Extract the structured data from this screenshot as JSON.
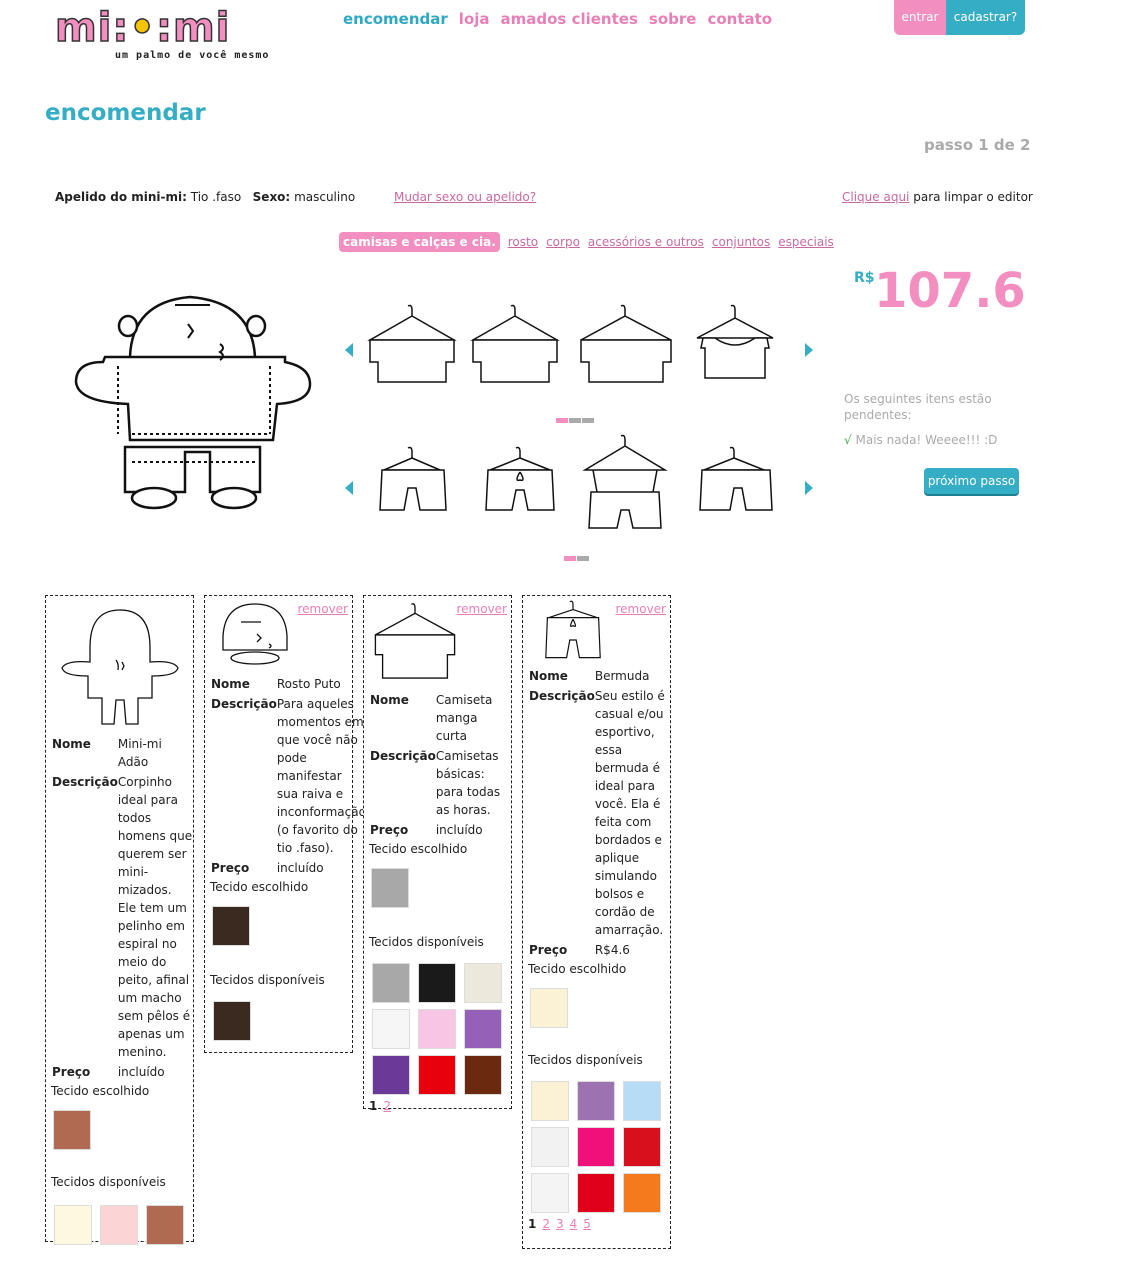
{
  "logo": {
    "wordmark_a": "mi",
    "wordmark_dot": "•",
    "wordmark_b": "mi",
    "tagline": "um palmo de você mesmo",
    "sep": ":"
  },
  "nav": {
    "items": [
      "encomendar",
      "loja",
      "amados clientes",
      "sobre",
      "contato"
    ],
    "active": "encomendar"
  },
  "auth": {
    "login": "entrar",
    "signup": "cadastrar?"
  },
  "page": {
    "title": "encomendar",
    "step": "passo 1 de 2"
  },
  "info": {
    "nickname_label": "Apelido do mini-mi:",
    "nickname_value": "Tio .faso",
    "sex_label": "Sexo:",
    "sex_value": "masculino",
    "change_link": "Mudar sexo ou apelido?",
    "clear_link": "Clique aqui",
    "clear_text": "para limpar o editor"
  },
  "categories": [
    "camisas e calças e cia.",
    "rosto",
    "corpo",
    "acessórios e outros",
    "conjuntos",
    "especiais"
  ],
  "carousel": {
    "shirts": [
      "hanger-shirt-icon",
      "hanger-shirt-icon",
      "hanger-shirt-icon",
      "hanger-tanktop-icon"
    ],
    "shorts": [
      "hanger-shorts-icon",
      "hanger-shorts-icon",
      "hanger-overall-shorts-icon",
      "hanger-shorts-icon"
    ]
  },
  "price": {
    "currency": "R$",
    "value": "107.6"
  },
  "pending": {
    "text": "Os seguintes itens estão pendentes:",
    "check": "√",
    "done": "Mais nada! Weeee!!! :D"
  },
  "next_button": "próximo passo",
  "colors": {
    "pink": "#f28fc0",
    "teal": "#35adc4",
    "grey": "#aaaaaa"
  },
  "cards": [
    {
      "name_label": "Nome",
      "name": "Mini-mi Adão",
      "desc_label": "Descrição",
      "desc": "Corpinho ideal para todos homens que querem ser mini-mizados. Ele tem um pelinho em espiral no meio do peito, afinal um macho sem pêlos é apenas um menino.",
      "price_label": "Preço",
      "price": "incluído",
      "chosen_label": "Tecido escolhido",
      "chosen_color": "#b06a52",
      "available_label": "Tecidos disponíveis",
      "available": [
        "#fdf8e0",
        "#fbd4d6",
        "#b06a52"
      ]
    },
    {
      "remove": "remover",
      "name_label": "Nome",
      "name": "Rosto Puto",
      "desc_label": "Descrição",
      "desc": "Para aqueles momentos em que você não pode manifestar sua raiva e inconformação (o favorito do tio .faso).",
      "price_label": "Preço",
      "price": "incluído",
      "chosen_label": "Tecido escolhido",
      "chosen_color": "#3a2a20",
      "available_label": "Tecidos disponíveis",
      "available": [
        "#3a2a20"
      ]
    },
    {
      "remove": "remover",
      "name_label": "Nome",
      "name": "Camiseta manga curta",
      "desc_label": "Descrição",
      "desc": "Camisetas básicas: para todas as horas.",
      "price_label": "Preço",
      "price": "incluído",
      "chosen_label": "Tecido escolhido",
      "chosen_color": "#a8a8a8",
      "available_label": "Tecidos disponíveis",
      "available": [
        "#a8a8a8",
        "#1a1a1a",
        "#ece8dc",
        "#f6f6f6",
        "#f6c6e4",
        "#9460b8",
        "#6b3a98",
        "#e8000c",
        "#6b2a10"
      ],
      "pages": [
        "1",
        "2"
      ]
    },
    {
      "remove": "remover",
      "name_label": "Nome",
      "name": "Bermuda",
      "desc_label": "Descrição",
      "desc": "Seu estilo é casual e/ou esportivo, essa bermuda é ideal para você. Ela é feita com bordados e aplique simulando bolsos e cordão de amarração.",
      "price_label": "Preço",
      "price": "R$4.6",
      "chosen_label": "Tecido escolhido",
      "chosen_color": "#fbf2d6",
      "available_label": "Tecidos disponíveis",
      "available": [
        "#fbf2d6",
        "#9c72b0",
        "#b6dcf6",
        "#f2f2f2",
        "#f0107a",
        "#d8101e",
        "#f4f4f4",
        "#e0001a",
        "#f47a1c"
      ],
      "pages": [
        "1",
        "2",
        "3",
        "4",
        "5"
      ]
    }
  ]
}
